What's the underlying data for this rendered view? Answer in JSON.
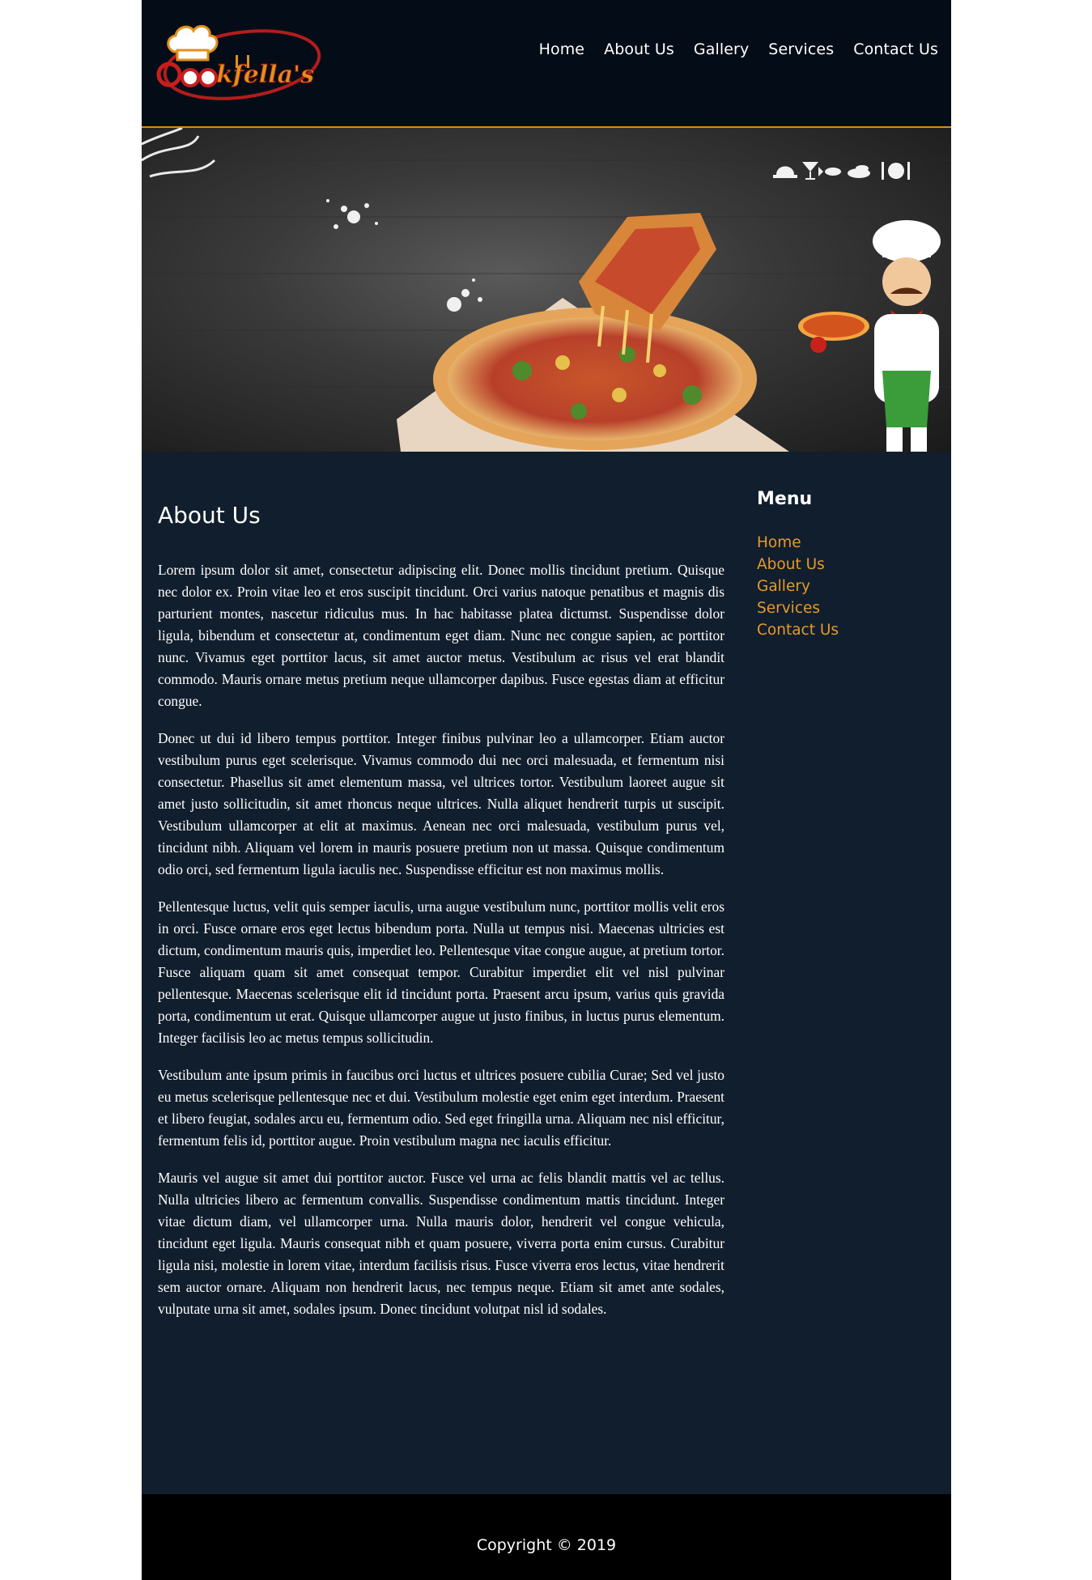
{
  "brand": {
    "logo_text": "Cookfella's"
  },
  "nav": {
    "items": [
      {
        "label": "Home"
      },
      {
        "label": "About Us"
      },
      {
        "label": "Gallery"
      },
      {
        "label": "Services"
      },
      {
        "label": "Contact Us"
      }
    ]
  },
  "hero": {
    "icons": [
      "cloche-icon",
      "cocktail-icon",
      "fish-icon",
      "dish-icon",
      "cutlery-plate-icon"
    ]
  },
  "main": {
    "title": "About Us",
    "paragraphs": [
      "Lorem ipsum dolor sit amet, consectetur adipiscing elit. Donec mollis tincidunt pretium. Quisque nec dolor ex. Proin vitae leo et eros suscipit tincidunt. Orci varius natoque penatibus et magnis dis parturient montes, nascetur ridiculus mus. In hac habitasse platea dictumst. Suspendisse dolor ligula, bibendum et consectetur at, condimentum eget diam. Nunc nec congue sapien, ac porttitor nunc. Vivamus eget porttitor lacus, sit amet auctor metus. Vestibulum ac risus vel erat blandit commodo. Mauris ornare metus pretium neque ullamcorper dapibus. Fusce egestas diam at efficitur congue.",
      "Donec ut dui id libero tempus porttitor. Integer finibus pulvinar leo a ullamcorper. Etiam auctor vestibulum purus eget scelerisque. Vivamus commodo dui nec orci malesuada, et fermentum nisi consectetur. Phasellus sit amet elementum massa, vel ultrices tortor. Vestibulum laoreet augue sit amet justo sollicitudin, sit amet rhoncus neque ultrices. Nulla aliquet hendrerit turpis ut suscipit. Vestibulum ullamcorper at elit at maximus. Aenean nec orci malesuada, vestibulum purus vel, tincidunt nibh. Aliquam vel lorem in mauris posuere pretium non ut massa. Quisque condimentum odio orci, sed fermentum ligula iaculis nec. Suspendisse efficitur est non maximus mollis.",
      "Pellentesque luctus, velit quis semper iaculis, urna augue vestibulum nunc, porttitor mollis velit eros in orci. Fusce ornare eros eget lectus bibendum porta. Nulla ut tempus nisi. Maecenas ultricies est dictum, condimentum mauris quis, imperdiet leo. Pellentesque vitae congue augue, at pretium tortor. Fusce aliquam quam sit amet consequat tempor. Curabitur imperdiet elit vel nisl pulvinar pellentesque. Maecenas scelerisque elit id tincidunt porta. Praesent arcu ipsum, varius quis gravida porta, condimentum ut erat. Quisque ullamcorper augue ut justo finibus, in luctus purus elementum. Integer facilisis leo ac metus tempus sollicitudin.",
      "Vestibulum ante ipsum primis in faucibus orci luctus et ultrices posuere cubilia Curae; Sed vel justo eu metus scelerisque pellentesque nec et dui. Vestibulum molestie eget enim eget interdum. Praesent et libero feugiat, sodales arcu eu, fermentum odio. Sed eget fringilla urna. Aliquam nec nisl efficitur, fermentum felis id, porttitor augue. Proin vestibulum magna nec iaculis efficitur.",
      "Mauris vel augue sit amet dui porttitor auctor. Fusce vel urna ac felis blandit mattis vel ac tellus. Nulla ultricies libero ac fermentum convallis. Suspendisse condimentum mattis tincidunt. Integer vitae dictum diam, vel ullamcorper urna. Nulla mauris dolor, hendrerit vel congue vehicula, tincidunt eget ligula. Mauris consequat nibh et quam posuere, viverra porta enim cursus. Curabitur ligula nisi, molestie in lorem vitae, interdum facilisis risus. Fusce viverra eros lectus, vitae hendrerit sem auctor ornare. Aliquam non hendrerit lacus, nec tempus neque. Etiam sit amet ante sodales, vulputate urna sit amet, sodales ipsum. Donec tincidunt volutpat nisl id sodales."
    ]
  },
  "sidebar": {
    "title": "Menu",
    "items": [
      {
        "label": "Home"
      },
      {
        "label": "About Us"
      },
      {
        "label": "Gallery"
      },
      {
        "label": "Services"
      },
      {
        "label": "Contact Us"
      }
    ]
  },
  "footer": {
    "copyright": "Copyright © 2019"
  },
  "colors": {
    "page_bg": "#111e2d",
    "header_bg": "#040d17",
    "accent": "#e59a2a",
    "footer_bg": "#000000"
  }
}
